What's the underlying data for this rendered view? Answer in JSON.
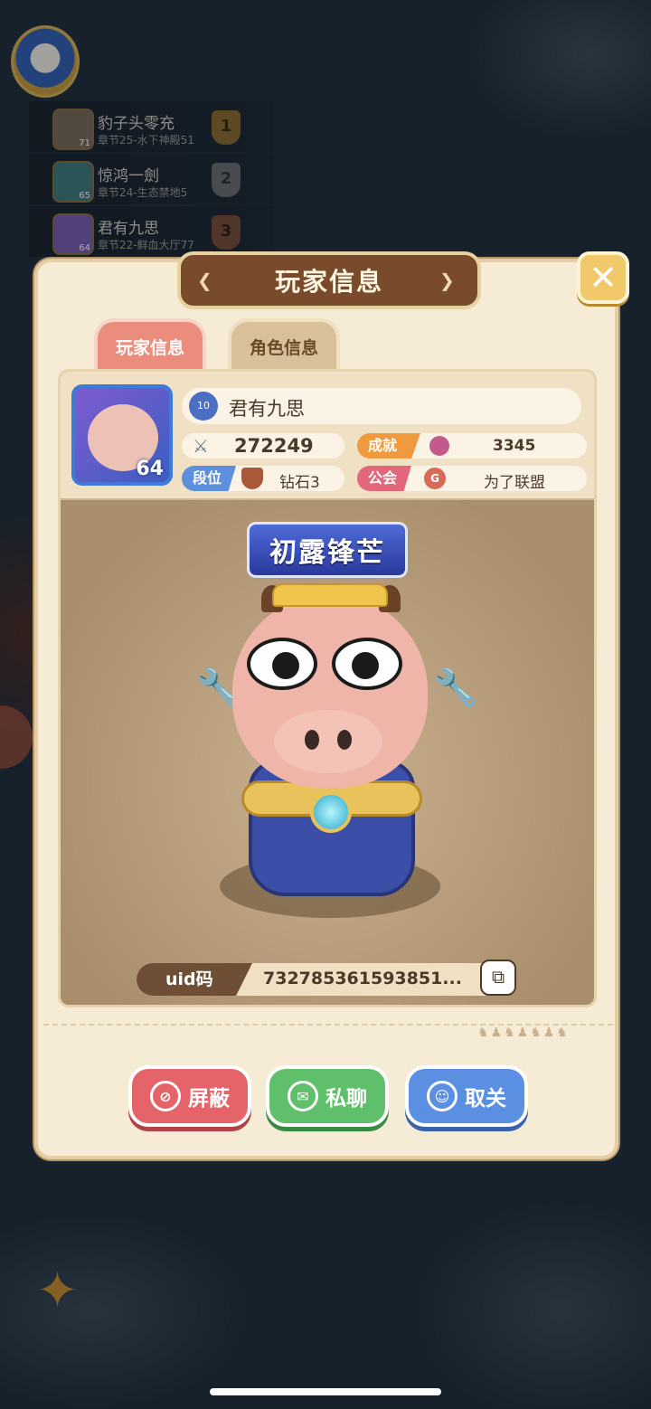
{
  "ranking": [
    {
      "name": "豹子头零充",
      "sub": "章节25-水下神殿51",
      "rank": "1",
      "level": "71"
    },
    {
      "name": "惊鸿一劍",
      "sub": "章节24-生态禁地5",
      "rank": "2",
      "level": "65"
    },
    {
      "name": "君有九思",
      "sub": "章节22-鲜血大厅77",
      "rank": "3",
      "level": "64"
    }
  ],
  "dialog": {
    "title": "玩家信息",
    "close_symbol": "✕",
    "tabs": {
      "player_info": "玩家信息",
      "role_info": "角色信息"
    }
  },
  "player": {
    "name": "君有九思",
    "vip_level": "10",
    "level": "64",
    "power": "272249",
    "achievement_label": "成就点",
    "achievement_value": "3345",
    "rank_label": "段位",
    "rank_value": "钻石3",
    "guild_label": "公会",
    "guild_value": "为了联盟",
    "guild_emblem": "G",
    "title_banner": "初露锋芒",
    "uid_label": "uid码",
    "uid_value": "732785361593851..."
  },
  "actions": {
    "block": "屏蔽",
    "chat": "私聊",
    "unfollow": "取关"
  },
  "colors": {
    "dialog_bg": "#f6ecd6",
    "title_plate": "#7a4b2b",
    "block_button": "#e5646a",
    "chat_button": "#5fbf6a",
    "unfollow_button": "#5b8fe2"
  }
}
